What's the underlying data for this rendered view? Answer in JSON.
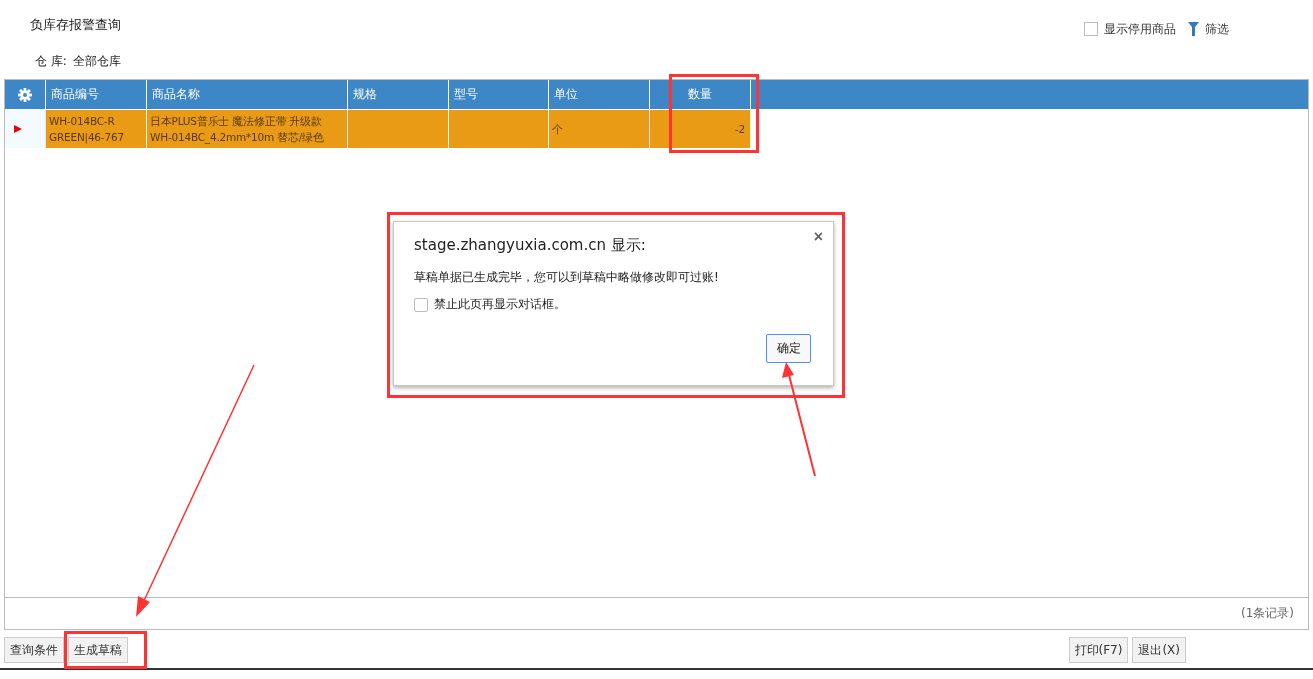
{
  "page": {
    "title": "负库存报警查询",
    "show_disabled": {
      "label": "显示停用商品",
      "checked": false
    },
    "filter": {
      "label": "筛选"
    },
    "warehouse": {
      "label": "仓 库:",
      "value": "全部仓库"
    }
  },
  "table": {
    "columns": [
      "商品编号",
      "商品名称",
      "规格",
      "型号",
      "单位",
      "数量"
    ],
    "rows": [
      {
        "selected": true,
        "cells": [
          "WH-014BC-R GREEN|46-767",
          "日本PLUS普乐士 魔法修正带 升级款 WH-014BC_4.2mm*10m 替芯/绿色",
          "",
          "",
          "个",
          "-2"
        ]
      }
    ],
    "footer": "(1条记录)"
  },
  "buttons_left": [
    "查询条件",
    "生成草稿"
  ],
  "buttons_right": [
    "打印(F7)",
    "退出(X)"
  ],
  "dialog": {
    "title": "stage.zhangyuxia.com.cn 显示:",
    "close": "×",
    "message": "草稿单据已生成完毕，您可以到草稿中略做修改即可过账!",
    "suppress": {
      "label": "禁止此页再显示对话框。",
      "checked": false
    },
    "ok": "确定"
  }
}
